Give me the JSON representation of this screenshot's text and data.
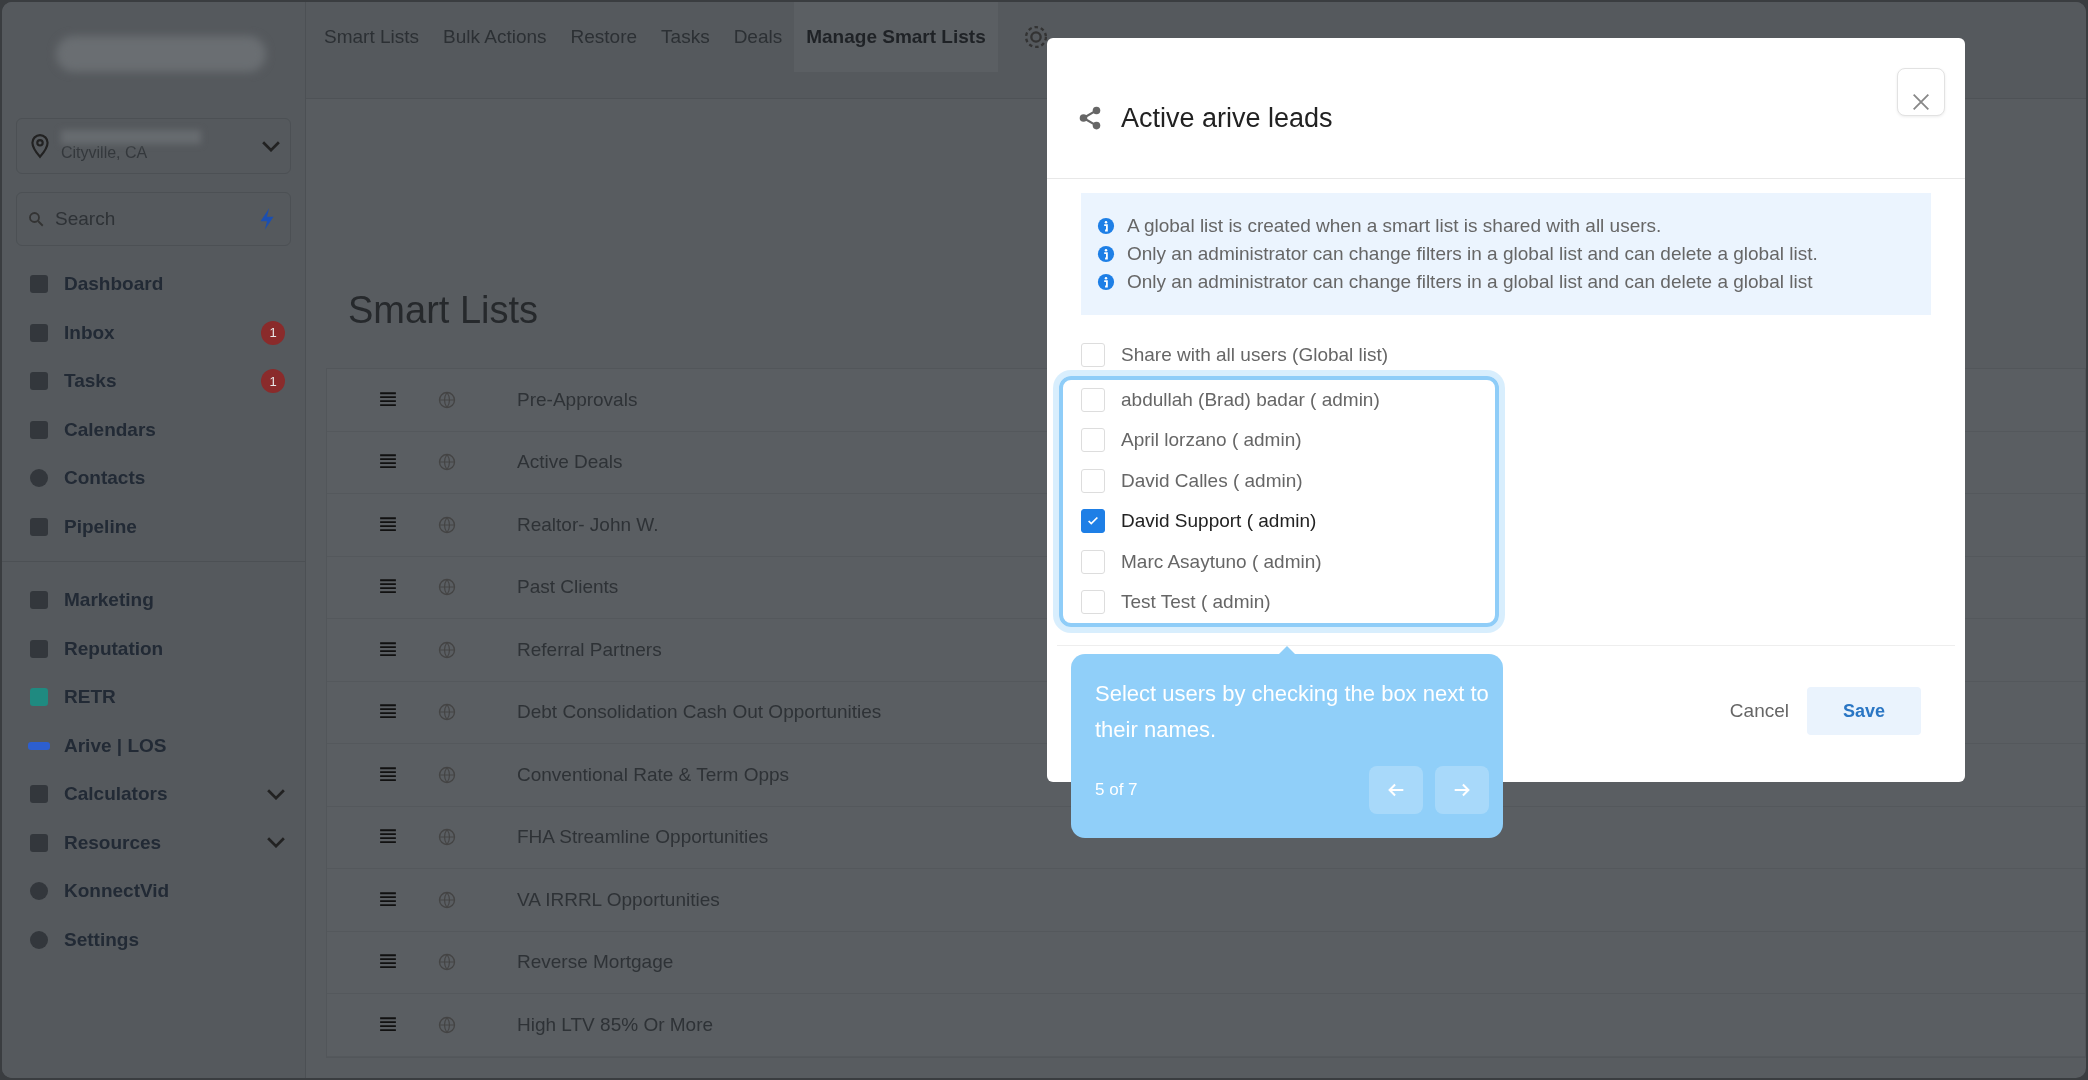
{
  "sidebar": {
    "location": {
      "subtitle": "Cityville, CA"
    },
    "search": {
      "placeholder": "Search"
    },
    "primary_items": [
      {
        "label": "Dashboard",
        "expandable": false
      },
      {
        "label": "Inbox",
        "badge": "1",
        "expandable": false
      },
      {
        "label": "Tasks",
        "badge": "1",
        "expandable": false
      },
      {
        "label": "Calendars",
        "expandable": false
      },
      {
        "label": "Contacts",
        "expandable": false
      },
      {
        "label": "Pipeline",
        "expandable": false
      }
    ],
    "secondary_items": [
      {
        "label": "Marketing",
        "expandable": false
      },
      {
        "label": "Reputation",
        "expandable": false
      },
      {
        "label": "RETR",
        "expandable": false
      },
      {
        "label": "Arive | LOS",
        "expandable": false
      },
      {
        "label": "Calculators",
        "expandable": true
      },
      {
        "label": "Resources",
        "expandable": true
      },
      {
        "label": "KonnectVid",
        "expandable": false
      },
      {
        "label": "Settings",
        "expandable": false
      }
    ]
  },
  "tabs": [
    {
      "label": "Smart Lists",
      "selected": false
    },
    {
      "label": "Bulk Actions",
      "selected": false
    },
    {
      "label": "Restore",
      "selected": false
    },
    {
      "label": "Tasks",
      "selected": false
    },
    {
      "label": "Deals",
      "selected": false
    },
    {
      "label": "Manage Smart Lists",
      "selected": true
    }
  ],
  "page_title": "Smart Lists",
  "smart_lists": [
    "Pre-Approvals",
    "Active Deals",
    "Realtor- John W.",
    "Past Clients",
    "Referral Partners",
    "Debt Consolidation Cash Out Opportunities",
    "Conventional Rate & Term Opps",
    "FHA Streamline Opportunities",
    "VA IRRRL Opportunities",
    "Reverse Mortgage",
    "High LTV 85% Or More"
  ],
  "modal": {
    "title": "Active arive leads",
    "info": [
      "A global list is created when a smart list is shared with all users.",
      "Only an administrator can change filters in a global list and can delete a global list.",
      "Only an administrator can change filters in a global list and can delete a global list"
    ],
    "share_all": {
      "label": "Share with all users (Global list)",
      "checked": false
    },
    "users": [
      {
        "label": "abdullah (Brad) badar ( admin)",
        "checked": false
      },
      {
        "label": "April lorzano ( admin)",
        "checked": false
      },
      {
        "label": "David Calles ( admin)",
        "checked": false
      },
      {
        "label": "David Support ( admin)",
        "checked": true
      },
      {
        "label": "Marc Asaytuno ( admin)",
        "checked": false
      },
      {
        "label": "Test Test ( admin)",
        "checked": false
      }
    ],
    "cancel": "Cancel",
    "save": "Save"
  },
  "tooltip": {
    "text": "Select users by checking the box next to their names.",
    "step": "5 of 7"
  }
}
